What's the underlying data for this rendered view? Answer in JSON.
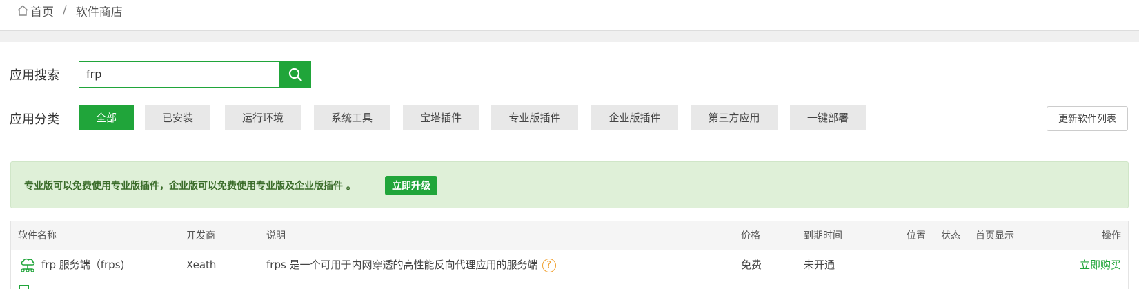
{
  "breadcrumb": {
    "home": "首页",
    "separator": "/",
    "current": "软件商店"
  },
  "search": {
    "label": "应用搜索",
    "value": "frp"
  },
  "categories": {
    "label": "应用分类",
    "items": [
      {
        "label": "全部",
        "active": true
      },
      {
        "label": "已安装"
      },
      {
        "label": "运行环境"
      },
      {
        "label": "系统工具"
      },
      {
        "label": "宝塔插件"
      },
      {
        "label": "专业版插件"
      },
      {
        "label": "企业版插件"
      },
      {
        "label": "第三方应用"
      },
      {
        "label": "一键部署"
      }
    ],
    "refresh_label": "更新软件列表"
  },
  "alert": {
    "text": "专业版可以免费使用专业版插件，企业版可以免费使用专业版及企业版插件 。",
    "button": "立即升级"
  },
  "table": {
    "headers": {
      "name": "软件名称",
      "developer": "开发商",
      "description": "说明",
      "price": "价格",
      "expiry": "到期时间",
      "location": "位置",
      "status": "状态",
      "homepage": "首页显示",
      "action": "操作"
    },
    "rows": [
      {
        "icon": "cloud-network-icon",
        "name": "frp 服务端（frps)",
        "developer": "Xeath",
        "description": "frps 是一个可用于内网穿透的高性能反向代理应用的服务端",
        "price": "免费",
        "expiry": "未开通",
        "action": "立即购买"
      }
    ]
  },
  "colors": {
    "accent": "#20a53a",
    "alert_bg": "#dff0d8",
    "help": "#f0a030"
  }
}
